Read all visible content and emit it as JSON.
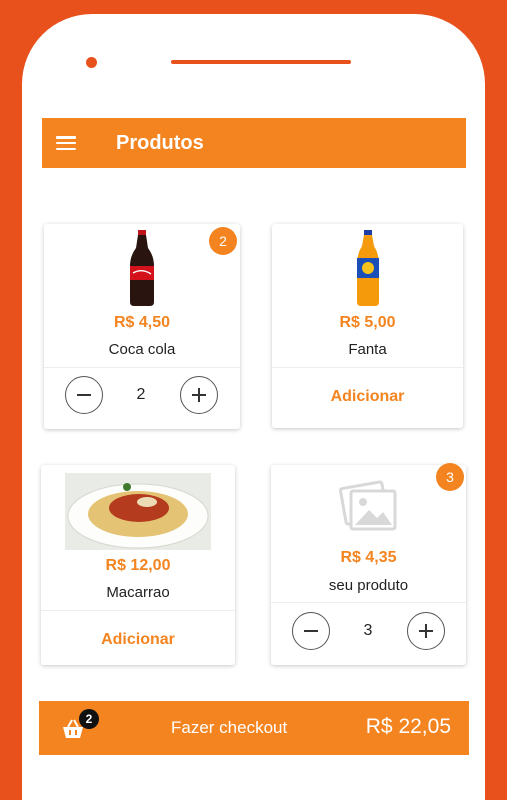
{
  "appbar": {
    "title": "Produtos",
    "menu_icon": "hamburger-menu-icon"
  },
  "colors": {
    "accent": "#F48420",
    "frame": "#E8511C"
  },
  "products": [
    {
      "name": "Coca cola",
      "price": "R$ 4,50",
      "image": "coca-cola-bottle-image",
      "badge": "2",
      "quantity": "2"
    },
    {
      "name": "Fanta",
      "price": "R$ 5,00",
      "image": "fanta-bottle-image",
      "add_label": "Adicionar"
    },
    {
      "name": "Macarrao",
      "price": "R$ 12,00",
      "image": "spaghetti-plate-image",
      "add_label": "Adicionar"
    },
    {
      "name": "seu produto",
      "price": "R$ 4,35",
      "image": "image-placeholder-icon",
      "badge": "3",
      "quantity": "3"
    }
  ],
  "checkout": {
    "label": "Fazer checkout",
    "total": "R$ 22,05",
    "cart_count": "2",
    "icon": "shopping-basket-icon"
  }
}
